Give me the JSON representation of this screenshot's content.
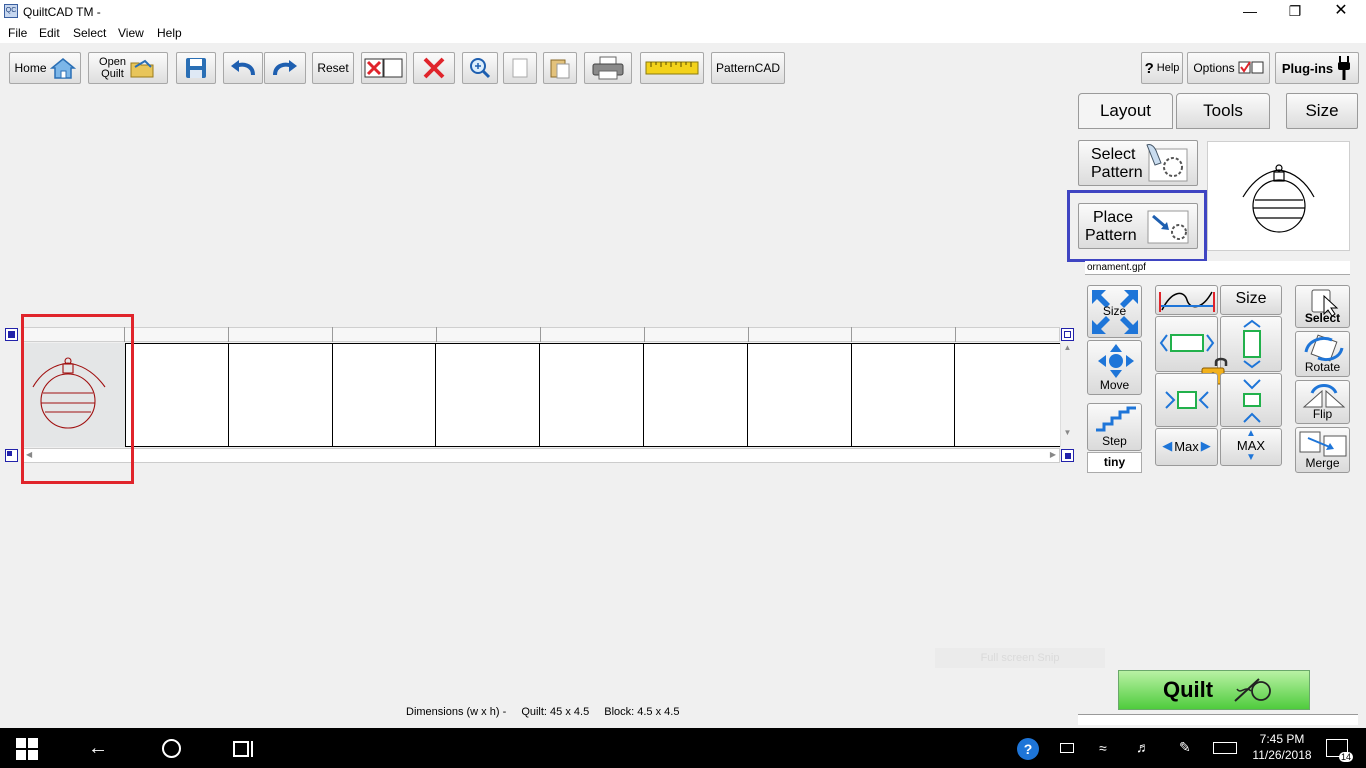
{
  "window": {
    "title": "QuiltCAD TM -",
    "app_icon": "QC"
  },
  "menu": [
    "File",
    "Edit",
    "Select",
    "View",
    "Help"
  ],
  "toolbar": {
    "home": "Home",
    "open_line1": "Open",
    "open_line2": "Quilt",
    "reset": "Reset",
    "patterncad": "PatternCAD",
    "help": "Help",
    "options": "Options",
    "plugins": "Plug-ins"
  },
  "tabs": {
    "layout": "Layout",
    "tools": "Tools",
    "size": "Size"
  },
  "pattern": {
    "select_line1": "Select",
    "select_line2": "Pattern",
    "place_line1": "Place",
    "place_line2": "Pattern",
    "filename": "ornament.gpf"
  },
  "tools": {
    "size": "Size",
    "move": "Move",
    "step": "Step",
    "tiny": "tiny",
    "size_top": "Size",
    "max": "Max",
    "max_caps": "MAX",
    "select": "Select",
    "rotate": "Rotate",
    "flip": "Flip",
    "merge": "Merge"
  },
  "quilt_button": "Quilt",
  "faded_overlay": "Full screen Snip",
  "status": {
    "label": "Dimensions (w x h) -",
    "quilt": "Quilt: 45 x 4.5",
    "block": "Block: 4.5 x 4.5"
  },
  "taskbar": {
    "time": "7:45 PM",
    "date": "11/26/2018",
    "notification_count": "14"
  },
  "colors": {
    "selection_red": "#e0242b",
    "highlight_blue": "#3f45c2",
    "pattern_red": "#a01010",
    "quilt_green": "#4fcc3d"
  }
}
